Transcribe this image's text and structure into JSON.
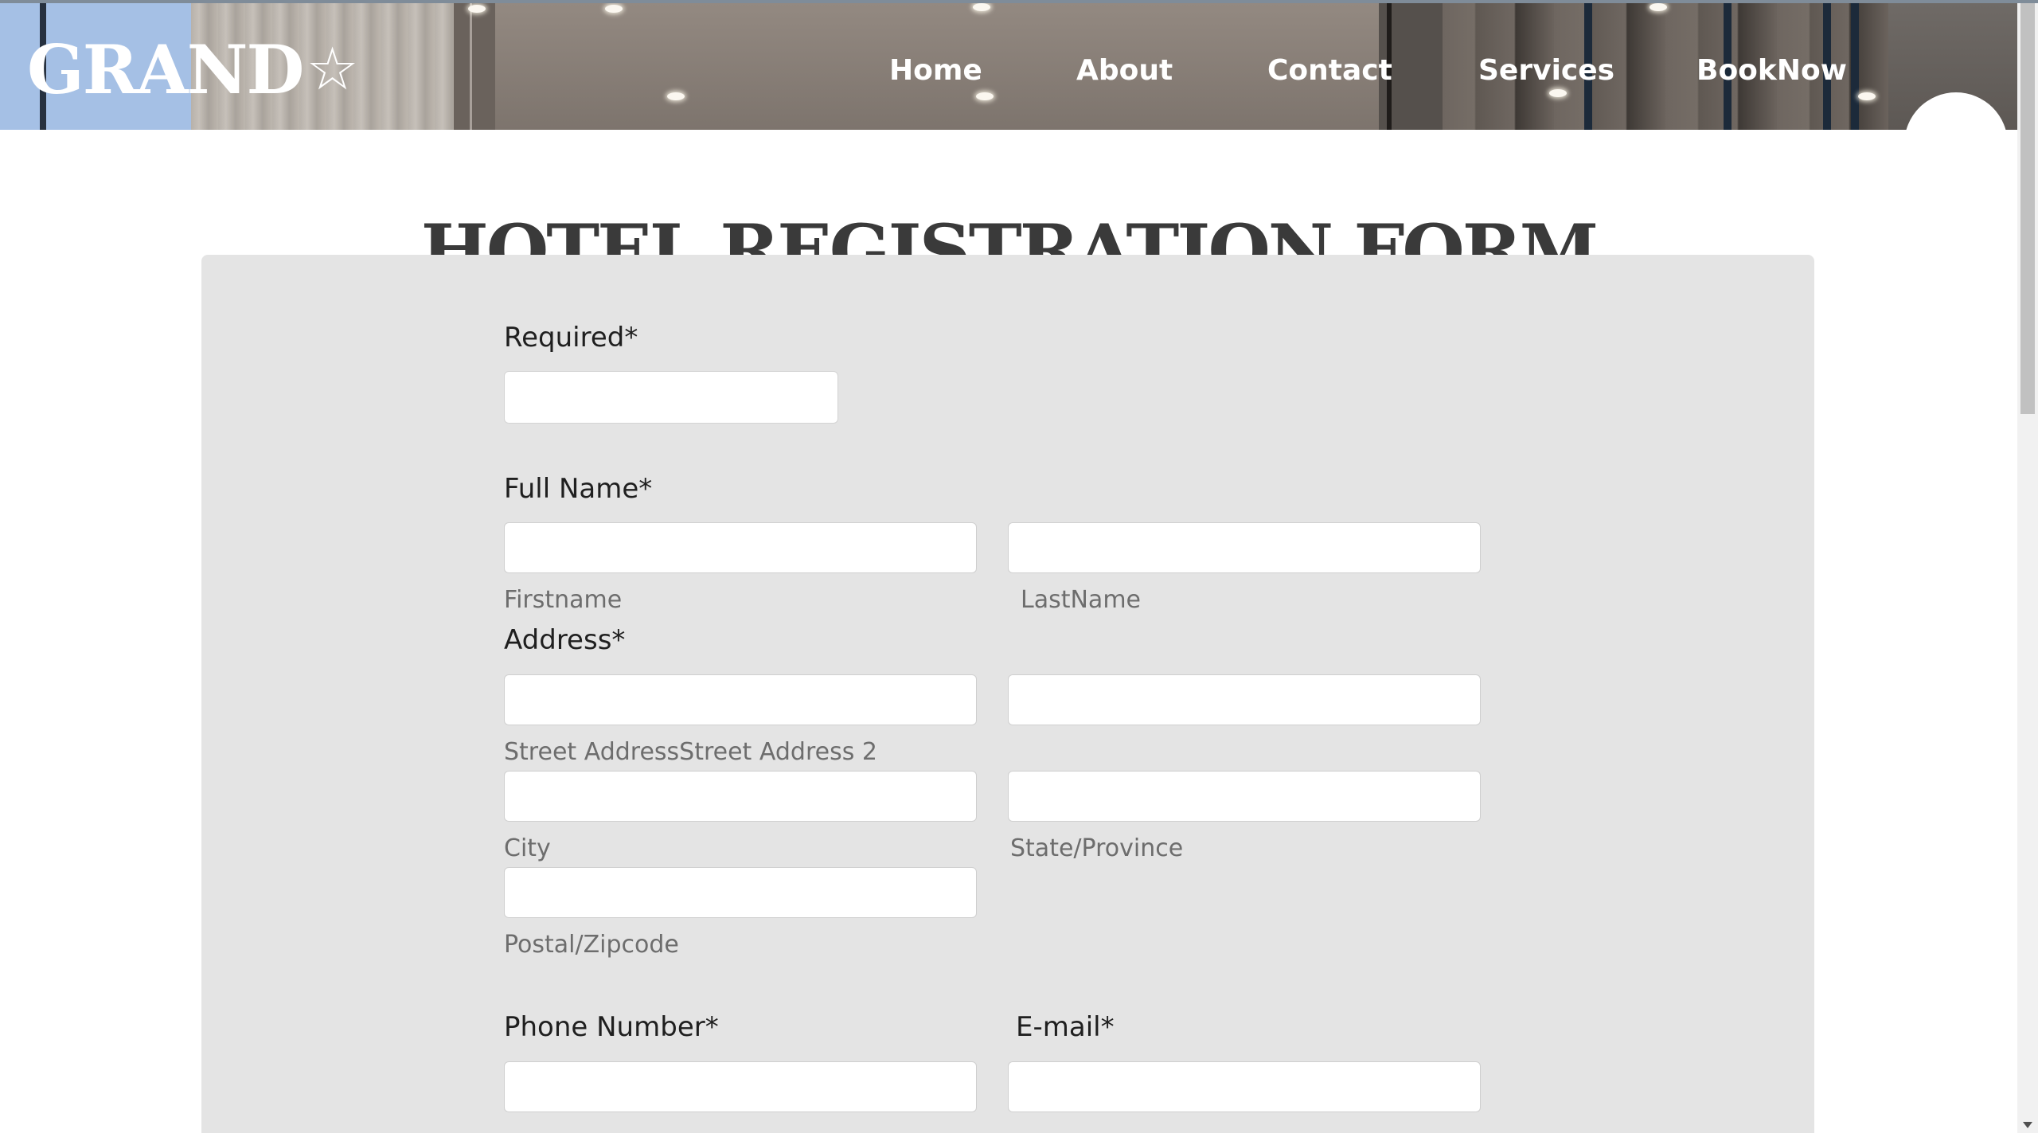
{
  "brand": {
    "name": "GRAND",
    "icon": "star-icon",
    "star_glyph": "☆"
  },
  "nav": {
    "items": [
      "Home",
      "About",
      "Contact",
      "Services",
      "BookNow"
    ]
  },
  "page": {
    "title": "HOTEL REGISTRATION FORM"
  },
  "form": {
    "required": {
      "label": "Required*",
      "selected": ""
    },
    "full_name": {
      "label": "Full Name*",
      "first_caption": "Firstname",
      "last_caption": "LastName"
    },
    "address": {
      "label": "Address*",
      "street_caption": "Street AddressStreet Address 2",
      "city_caption": "City",
      "state_caption": "State/Province",
      "zip_caption": "Postal/Zipcode"
    },
    "phone": {
      "label": "Phone Number*"
    },
    "email": {
      "label": "E-mail*"
    }
  },
  "colors": {
    "panel_bg": "#e4e4e4",
    "title_text": "#3a3a3a",
    "nav_text": "#ffffff",
    "brand_block": "#a5c0e5"
  }
}
